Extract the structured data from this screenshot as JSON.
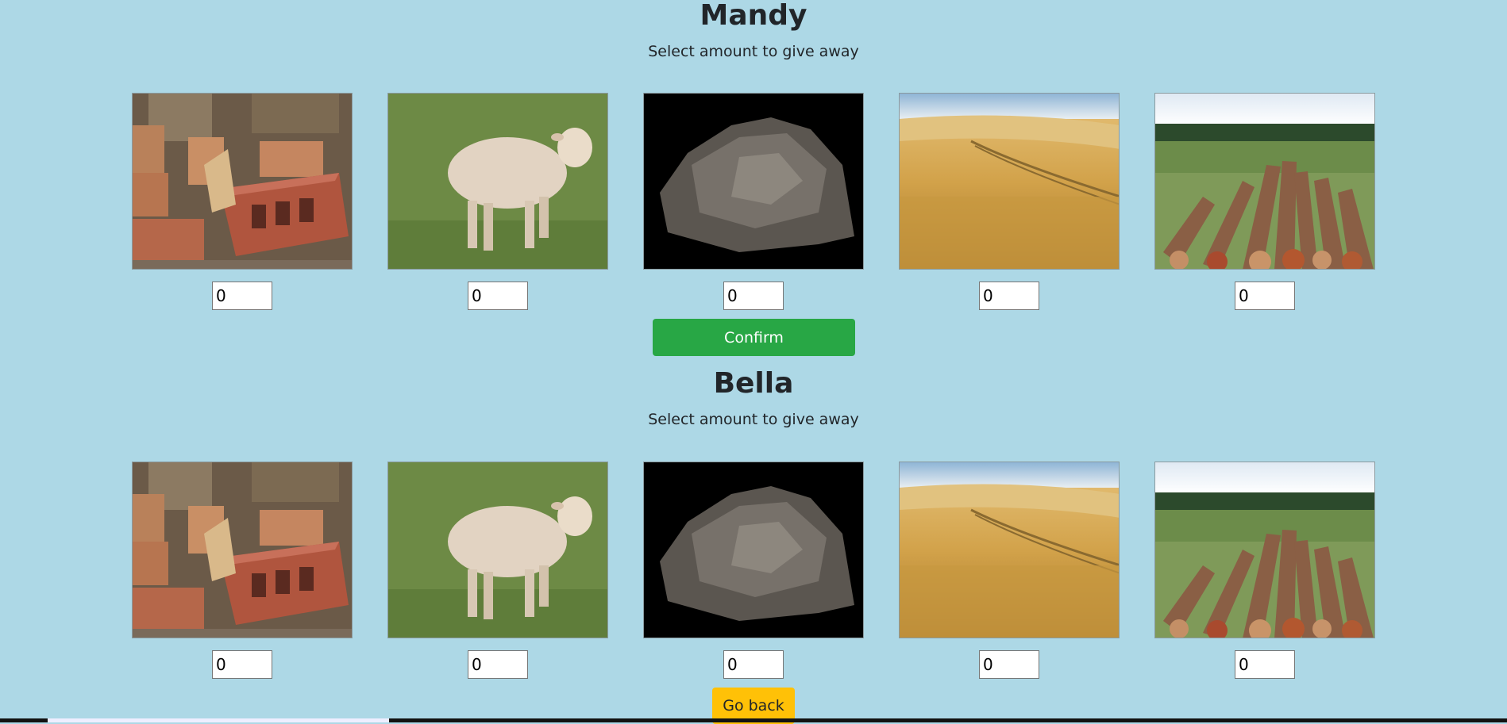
{
  "players": [
    {
      "name": "Mandy",
      "subtitle": "Select amount to give away",
      "resources": [
        {
          "icon": "bricks-image",
          "value": "0"
        },
        {
          "icon": "sheep-image",
          "value": "0"
        },
        {
          "icon": "ore-rock-image",
          "value": "0"
        },
        {
          "icon": "wheat-field-image",
          "value": "0"
        },
        {
          "icon": "lumber-logs-image",
          "value": "0"
        }
      ]
    },
    {
      "name": "Bella",
      "subtitle": "Select amount to give away",
      "resources": [
        {
          "icon": "bricks-image",
          "value": "0"
        },
        {
          "icon": "sheep-image",
          "value": "0"
        },
        {
          "icon": "ore-rock-image",
          "value": "0"
        },
        {
          "icon": "wheat-field-image",
          "value": "0"
        },
        {
          "icon": "lumber-logs-image",
          "value": "0"
        }
      ]
    }
  ],
  "buttons": {
    "confirm_label": "Confirm",
    "go_back_label": "Go back"
  },
  "colors": {
    "background": "#add8e6",
    "confirm": "#28a745",
    "go_back": "#ffc107"
  }
}
